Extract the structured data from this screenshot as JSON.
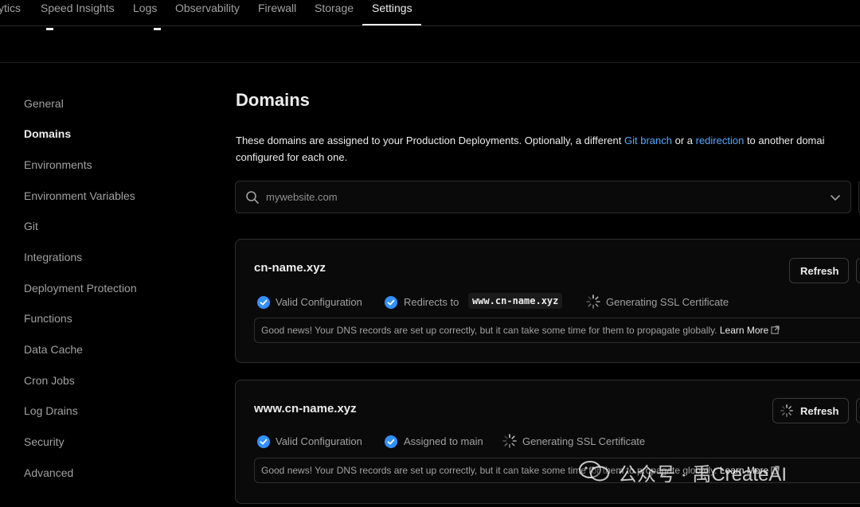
{
  "topnav": {
    "tabs": [
      {
        "label": "ytics"
      },
      {
        "label": "Speed Insights"
      },
      {
        "label": "Logs"
      },
      {
        "label": "Observability"
      },
      {
        "label": "Firewall"
      },
      {
        "label": "Storage"
      },
      {
        "label": "Settings",
        "active": true
      }
    ]
  },
  "sidebar": {
    "items": [
      {
        "label": "General"
      },
      {
        "label": "Domains",
        "active": true
      },
      {
        "label": "Environments"
      },
      {
        "label": "Environment Variables"
      },
      {
        "label": "Git"
      },
      {
        "label": "Integrations"
      },
      {
        "label": "Deployment Protection"
      },
      {
        "label": "Functions"
      },
      {
        "label": "Data Cache"
      },
      {
        "label": "Cron Jobs"
      },
      {
        "label": "Log Drains"
      },
      {
        "label": "Security"
      },
      {
        "label": "Advanced"
      }
    ]
  },
  "main": {
    "title": "Domains",
    "description_1": "These domains are assigned to your Production Deployments. Optionally, a different ",
    "link_git_branch": "Git branch",
    "description_2": " or a ",
    "link_redirection": "redirection",
    "description_3": " to another domai",
    "description_4": "configured for each one.",
    "search": {
      "value": "mywebsite.com",
      "icon": "search-icon"
    },
    "domains": [
      {
        "name": "cn-name.xyz",
        "refresh_label": "Refresh",
        "refresh_loading": false,
        "status_1": "Valid Configuration",
        "status_2_prefix": "Redirects to",
        "status_2_code": "www.cn-name.xyz",
        "status_3": "Generating SSL Certificate",
        "notice": "Good news! Your DNS records are set up correctly, but it can take some time for them to propagate globally.",
        "learn_more": "Learn More"
      },
      {
        "name": "www.cn-name.xyz",
        "refresh_label": "Refresh",
        "refresh_loading": true,
        "status_1": "Valid Configuration",
        "status_2": "Assigned to main",
        "status_3": "Generating SSL Certificate",
        "notice": "Good news! Your DNS records are set up correctly, but it can take some time for them to propagate globally.",
        "learn_more": "Learn More"
      }
    ]
  },
  "watermark": {
    "text": "公众号 · 禹CreateAI"
  },
  "colors": {
    "accent_blue": "#3291ff",
    "link": "#52a8ff",
    "background": "#000000"
  }
}
